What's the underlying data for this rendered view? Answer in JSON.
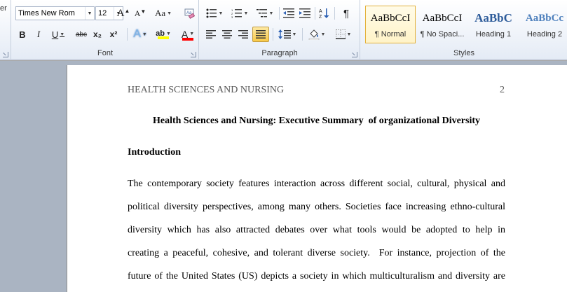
{
  "ribbon": {
    "clipboard_fragment": "er",
    "font": {
      "label": "Font",
      "font_name": "Times New Rom",
      "font_size": "12",
      "grow": "A",
      "shrink": "A",
      "change_case": "Aa",
      "bold": "B",
      "italic": "I",
      "underline": "U",
      "strikethrough": "abc",
      "subscript": "x₂",
      "superscript": "x²",
      "text_effects": "A",
      "highlight": "ab",
      "font_color": "A",
      "clear_format_icon": "eraser-icon"
    },
    "paragraph": {
      "label": "Paragraph",
      "pilcrow": "¶"
    },
    "styles": {
      "label": "Styles",
      "items": [
        {
          "sample": "AaBbCcI",
          "name": "¶ Normal"
        },
        {
          "sample": "AaBbCcI",
          "name": "¶ No Spaci..."
        },
        {
          "sample": "AaBbC",
          "name": "Heading 1"
        },
        {
          "sample": "AaBbCc",
          "name": "Heading 2"
        }
      ]
    },
    "colors": {
      "highlight": "#ffff00",
      "font_color": "#ff0000",
      "heading": "#2e5c9a",
      "selected_border": "#e3b23c"
    }
  },
  "document": {
    "running_head": "HEALTH SCIENCES AND NURSING",
    "page_number": "2",
    "title": "Health Sciences and Nursing: Executive Summary  of organizational Diversity",
    "section_heading": "Introduction",
    "lines": [
      "The contemporary society features interaction across different social, cultural, physical and",
      "political diversity perspectives, among many others. Societies face increasing ethno-cultural",
      "diversity which has also attracted debates over what tools would be adopted to help in",
      "creating a peaceful, cohesive, and tolerant diverse society.  For instance, projection of the",
      "future of the United States (US) depicts a society in which multiculturalism and diversity are"
    ]
  }
}
